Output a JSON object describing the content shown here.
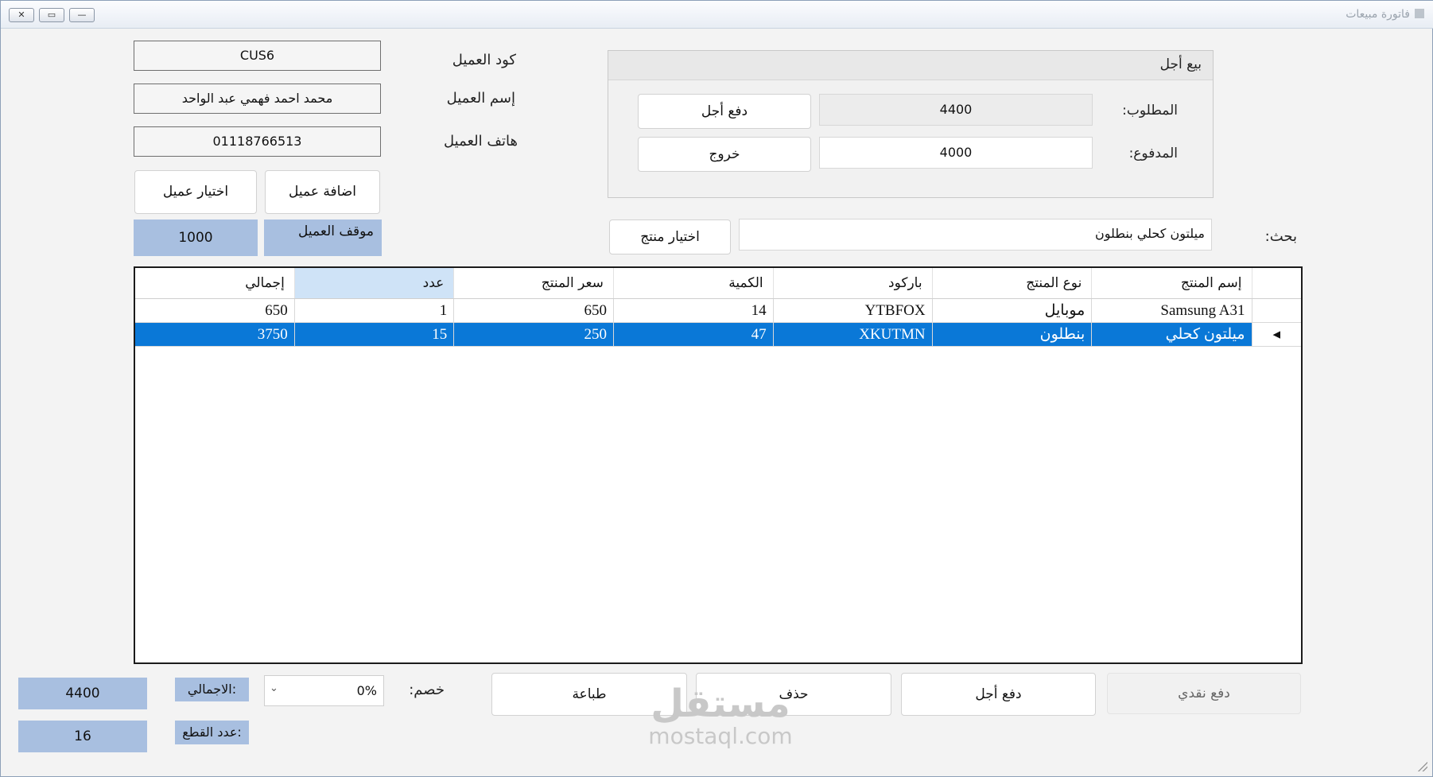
{
  "window": {
    "title": "فاتورة مبيعات",
    "controls": {
      "close": "✕",
      "maximize": "▭",
      "minimize": "—"
    }
  },
  "customer": {
    "code_label": "كود العميل",
    "code_value": "CUS6",
    "name_label": "إسم العميل",
    "name_value": "محمد احمد فهمي عبد الواحد",
    "phone_label": "هاتف العميل",
    "phone_value": "01118766513",
    "add_button": "اضافة عميل",
    "select_button": "اختيار عميل",
    "balance_label": "موقف العميل",
    "balance_value": "1000"
  },
  "credit_sale": {
    "title": "بيع أجل",
    "required_label": "المطلوب:",
    "required_value": "4400",
    "paid_label": "المدفوع:",
    "paid_value": "4000",
    "pay_later_button": "دفع أجل",
    "exit_button": "خروج"
  },
  "search": {
    "label": "بحث:",
    "value": "ميلتون كحلي بنطلون",
    "select_product_button": "اختيار منتج"
  },
  "table": {
    "columns": [
      "إسم المنتج",
      "نوع المنتج",
      "باركود",
      "الكمية",
      "سعر المنتج",
      "عدد",
      "إجمالي"
    ],
    "rows": [
      {
        "name": "Samsung A31",
        "type": "موبايل",
        "barcode": "YTBFOX",
        "qty": "14",
        "price": "650",
        "count": "1",
        "total": "650"
      },
      {
        "name": "ميلتون كحلي",
        "type": "بنطلون",
        "barcode": "XKUTMN",
        "qty": "47",
        "price": "250",
        "count": "15",
        "total": "3750"
      }
    ],
    "selected_row_marker": "◂"
  },
  "footer": {
    "cash_pay_button": "دفع نقدي",
    "credit_pay_button": "دفع أجل",
    "delete_button": "حذف",
    "print_button": "طباعة",
    "discount_label": "خصم:",
    "discount_value": "0%",
    "total_label": "الاجمالي:",
    "total_value": "4400",
    "pieces_label": "عدد القطع:",
    "pieces_value": "16"
  },
  "watermark": {
    "arabic": "مستقل",
    "latin": "mostaql.com"
  },
  "colors": {
    "accent_selection": "#0a78d7",
    "info_box": "#a8bfe0",
    "header_selected": "#cfe3f7"
  }
}
